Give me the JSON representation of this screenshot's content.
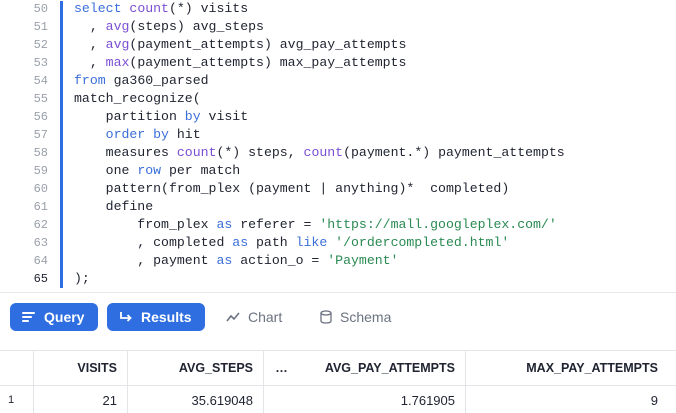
{
  "editor": {
    "lines": [
      {
        "num": "50",
        "tokens": [
          {
            "t": "select ",
            "c": "kw"
          },
          {
            "t": "count",
            "c": "fn"
          },
          {
            "t": "(*) visits",
            "c": ""
          }
        ]
      },
      {
        "num": "51",
        "tokens": [
          {
            "t": "  , ",
            "c": ""
          },
          {
            "t": "avg",
            "c": "fn"
          },
          {
            "t": "(steps) avg_steps",
            "c": ""
          }
        ]
      },
      {
        "num": "52",
        "tokens": [
          {
            "t": "  , ",
            "c": ""
          },
          {
            "t": "avg",
            "c": "fn"
          },
          {
            "t": "(payment_attempts) avg_pay_attempts",
            "c": ""
          }
        ]
      },
      {
        "num": "53",
        "tokens": [
          {
            "t": "  , ",
            "c": ""
          },
          {
            "t": "max",
            "c": "fn"
          },
          {
            "t": "(payment_attempts) max_pay_attempts",
            "c": ""
          }
        ]
      },
      {
        "num": "54",
        "tokens": [
          {
            "t": "from ",
            "c": "kw"
          },
          {
            "t": "ga360_parsed",
            "c": ""
          }
        ]
      },
      {
        "num": "55",
        "tokens": [
          {
            "t": "match_recognize(",
            "c": ""
          }
        ]
      },
      {
        "num": "56",
        "tokens": [
          {
            "t": "    partition ",
            "c": ""
          },
          {
            "t": "by",
            "c": "kw"
          },
          {
            "t": " visit",
            "c": ""
          }
        ]
      },
      {
        "num": "57",
        "tokens": [
          {
            "t": "    ",
            "c": ""
          },
          {
            "t": "order by",
            "c": "kw"
          },
          {
            "t": " hit",
            "c": ""
          }
        ]
      },
      {
        "num": "58",
        "tokens": [
          {
            "t": "    measures ",
            "c": ""
          },
          {
            "t": "count",
            "c": "fn"
          },
          {
            "t": "(*) steps, ",
            "c": ""
          },
          {
            "t": "count",
            "c": "fn"
          },
          {
            "t": "(payment.*) payment_attempts",
            "c": ""
          }
        ]
      },
      {
        "num": "59",
        "tokens": [
          {
            "t": "    one ",
            "c": ""
          },
          {
            "t": "row",
            "c": "kw"
          },
          {
            "t": " per match",
            "c": ""
          }
        ]
      },
      {
        "num": "60",
        "tokens": [
          {
            "t": "    pattern(from_plex (payment | anything)*  completed)",
            "c": ""
          }
        ]
      },
      {
        "num": "61",
        "tokens": [
          {
            "t": "    define",
            "c": ""
          }
        ]
      },
      {
        "num": "62",
        "tokens": [
          {
            "t": "        from_plex ",
            "c": ""
          },
          {
            "t": "as",
            "c": "kw"
          },
          {
            "t": " referer = ",
            "c": ""
          },
          {
            "t": "'https://mall.googleplex.com/'",
            "c": "str"
          }
        ]
      },
      {
        "num": "63",
        "tokens": [
          {
            "t": "        , completed ",
            "c": ""
          },
          {
            "t": "as",
            "c": "kw"
          },
          {
            "t": " path ",
            "c": ""
          },
          {
            "t": "like",
            "c": "kw"
          },
          {
            "t": " ",
            "c": ""
          },
          {
            "t": "'/ordercompleted.html'",
            "c": "str"
          }
        ]
      },
      {
        "num": "64",
        "tokens": [
          {
            "t": "        , payment ",
            "c": ""
          },
          {
            "t": "as",
            "c": "kw"
          },
          {
            "t": " action_o = ",
            "c": ""
          },
          {
            "t": "'Payment'",
            "c": "str"
          }
        ]
      },
      {
        "num": "65",
        "tokens": [
          {
            "t": ");",
            "c": ""
          }
        ],
        "active": true
      }
    ]
  },
  "tabs": {
    "query": {
      "label": "Query",
      "icon": "lines-icon"
    },
    "results": {
      "label": "Results",
      "icon": "return-arrow-icon"
    },
    "chart": {
      "label": "Chart",
      "icon": "trend-line-icon"
    },
    "schema": {
      "label": "Schema",
      "icon": "database-icon"
    }
  },
  "results": {
    "columns": [
      "VISITS",
      "AVG_STEPS",
      "…",
      "AVG_PAY_ATTEMPTS",
      "MAX_PAY_ATTEMPTS"
    ],
    "rows": [
      {
        "index": "1",
        "cells": [
          "21",
          "35.619048",
          "",
          "1.761905",
          "9"
        ]
      }
    ]
  },
  "colors": {
    "accent": "#2f6ee0",
    "keyword": "#3b6fd9",
    "function": "#7a4ed3",
    "string": "#2a8a52"
  }
}
